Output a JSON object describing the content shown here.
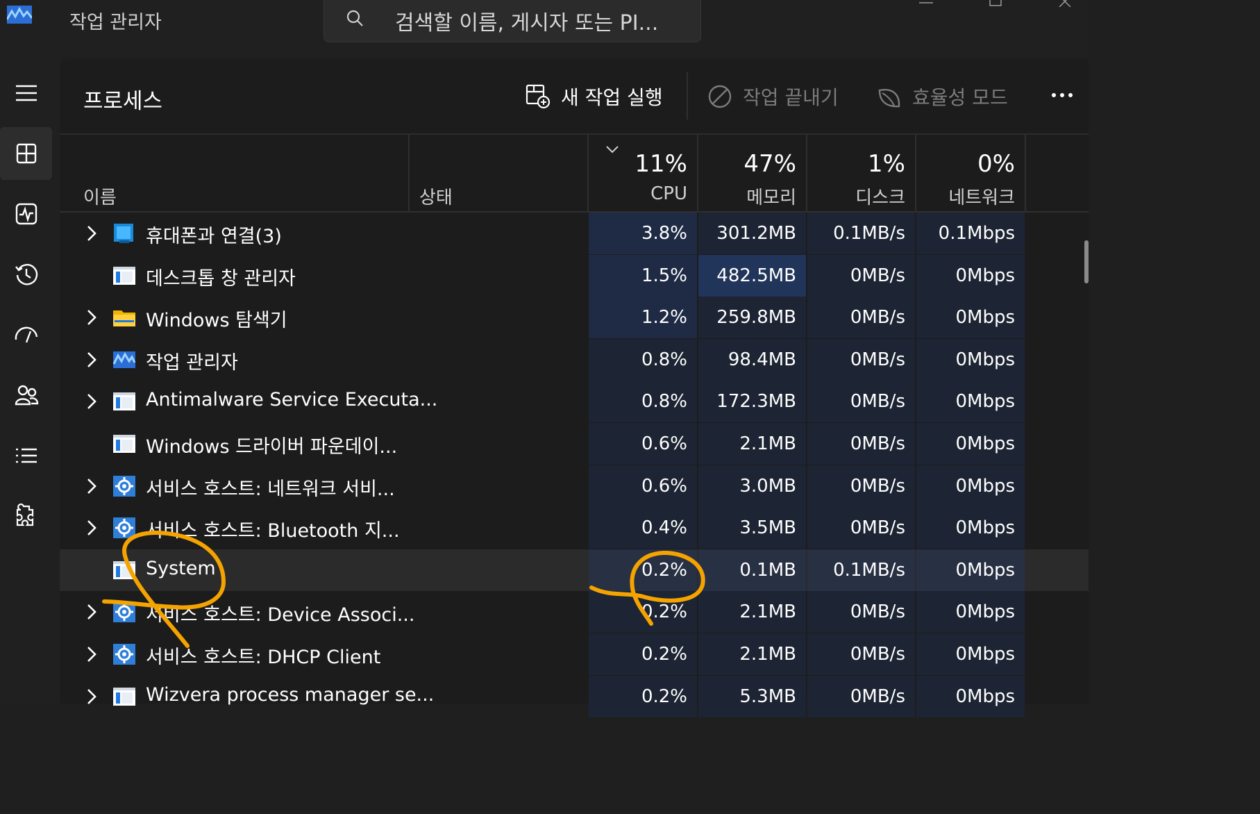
{
  "app": {
    "title": "작업 관리자"
  },
  "search": {
    "placeholder": "검색할 이름, 게시자 또는 PI..."
  },
  "nav": {
    "items": [
      {
        "icon": "hamburger-menu-icon"
      },
      {
        "icon": "processes-icon",
        "active": true
      },
      {
        "icon": "performance-icon"
      },
      {
        "icon": "app-history-icon"
      },
      {
        "icon": "startup-apps-icon"
      },
      {
        "icon": "users-icon"
      },
      {
        "icon": "details-icon"
      },
      {
        "icon": "services-icon"
      }
    ]
  },
  "toolbar": {
    "title": "프로세스",
    "run_task_label": "새 작업 실행",
    "end_task_label": "작업 끝내기",
    "efficiency_label": "효율성 모드"
  },
  "columns": {
    "name": "이름",
    "status": "상태",
    "cpu": {
      "pct": "11%",
      "label": "CPU"
    },
    "memory": {
      "pct": "47%",
      "label": "메모리"
    },
    "disk": {
      "pct": "1%",
      "label": "디스크"
    },
    "network": {
      "pct": "0%",
      "label": "네트워크"
    }
  },
  "processes": [
    {
      "name": "휴대폰과 연결(3)",
      "icon": "phone-link-icon",
      "expandable": true,
      "cpu": "3.8%",
      "memory": "301.2MB",
      "disk": "0.1MB/s",
      "network": "0.1Mbps",
      "cpu_heat": 1,
      "mem_heat": 0
    },
    {
      "name": "데스크톱 창 관리자",
      "icon": "app-window-icon",
      "expandable": false,
      "cpu": "1.5%",
      "memory": "482.5MB",
      "disk": "0MB/s",
      "network": "0Mbps",
      "cpu_heat": 1,
      "mem_heat": 2
    },
    {
      "name": "Windows 탐색기",
      "icon": "folder-icon",
      "expandable": true,
      "cpu": "1.2%",
      "memory": "259.8MB",
      "disk": "0MB/s",
      "network": "0Mbps",
      "cpu_heat": 1,
      "mem_heat": 0
    },
    {
      "name": "작업 관리자",
      "icon": "task-manager-icon",
      "expandable": true,
      "cpu": "0.8%",
      "memory": "98.4MB",
      "disk": "0MB/s",
      "network": "0Mbps",
      "cpu_heat": 0,
      "mem_heat": 0
    },
    {
      "name": "Antimalware Service Executa...",
      "icon": "app-window-icon",
      "expandable": true,
      "cpu": "0.8%",
      "memory": "172.3MB",
      "disk": "0MB/s",
      "network": "0Mbps",
      "cpu_heat": 0,
      "mem_heat": 0
    },
    {
      "name": "Windows 드라이버 파운데이...",
      "icon": "app-window-icon",
      "expandable": false,
      "cpu": "0.6%",
      "memory": "2.1MB",
      "disk": "0MB/s",
      "network": "0Mbps",
      "cpu_heat": 0,
      "mem_heat": 0
    },
    {
      "name": "서비스 호스트: 네트워크 서비...",
      "icon": "gear-service-icon",
      "expandable": true,
      "cpu": "0.6%",
      "memory": "3.0MB",
      "disk": "0MB/s",
      "network": "0Mbps",
      "cpu_heat": 0,
      "mem_heat": 0
    },
    {
      "name": "서비스 호스트: Bluetooth 지...",
      "icon": "gear-service-icon",
      "expandable": true,
      "cpu": "0.4%",
      "memory": "3.5MB",
      "disk": "0MB/s",
      "network": "0Mbps",
      "cpu_heat": 0,
      "mem_heat": 0
    },
    {
      "name": "System",
      "icon": "app-window-icon",
      "expandable": false,
      "selected": true,
      "cpu": "0.2%",
      "memory": "0.1MB",
      "disk": "0.1MB/s",
      "network": "0Mbps",
      "cpu_heat": 0,
      "mem_heat": 0
    },
    {
      "name": "서비스 호스트: Device Associ...",
      "icon": "gear-service-icon",
      "expandable": true,
      "cpu": "0.2%",
      "memory": "2.1MB",
      "disk": "0MB/s",
      "network": "0Mbps",
      "cpu_heat": 0,
      "mem_heat": 0
    },
    {
      "name": "서비스 호스트: DHCP Client",
      "icon": "gear-service-icon",
      "expandable": true,
      "cpu": "0.2%",
      "memory": "2.1MB",
      "disk": "0MB/s",
      "network": "0Mbps",
      "cpu_heat": 0,
      "mem_heat": 0
    },
    {
      "name": "Wizvera process manager se...",
      "icon": "app-window-icon",
      "expandable": true,
      "cpu": "0.2%",
      "memory": "5.3MB",
      "disk": "0MB/s",
      "network": "0Mbps",
      "cpu_heat": 0,
      "mem_heat": 0
    }
  ],
  "colors": {
    "accent_annotation": "#f5a300",
    "heat_low": "#1d2433",
    "heat_mid": "#1f2b45",
    "heat_high": "#21345a"
  }
}
